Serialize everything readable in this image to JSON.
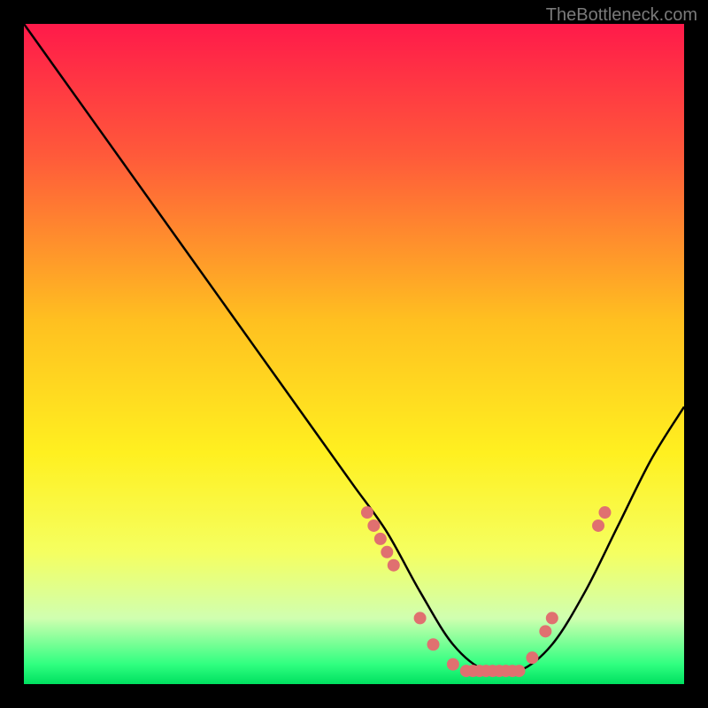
{
  "watermark": "TheBottleneck.com",
  "chart_data": {
    "type": "line",
    "title": "",
    "xlabel": "",
    "ylabel": "",
    "xlim": [
      0,
      100
    ],
    "ylim": [
      0,
      100
    ],
    "curve": {
      "name": "bottleneck-curve",
      "x": [
        0,
        5,
        10,
        15,
        20,
        25,
        30,
        35,
        40,
        45,
        50,
        55,
        60,
        65,
        70,
        75,
        80,
        85,
        90,
        95,
        100
      ],
      "y": [
        100,
        93,
        86,
        79,
        72,
        65,
        58,
        51,
        44,
        37,
        30,
        23,
        14,
        6,
        2,
        2,
        6,
        14,
        24,
        34,
        42
      ]
    },
    "markers": [
      {
        "x": 52,
        "y": 26
      },
      {
        "x": 53,
        "y": 24
      },
      {
        "x": 54,
        "y": 22
      },
      {
        "x": 55,
        "y": 20
      },
      {
        "x": 56,
        "y": 18
      },
      {
        "x": 60,
        "y": 10
      },
      {
        "x": 62,
        "y": 6
      },
      {
        "x": 65,
        "y": 3
      },
      {
        "x": 67,
        "y": 2
      },
      {
        "x": 68,
        "y": 2
      },
      {
        "x": 69,
        "y": 2
      },
      {
        "x": 70,
        "y": 2
      },
      {
        "x": 71,
        "y": 2
      },
      {
        "x": 72,
        "y": 2
      },
      {
        "x": 73,
        "y": 2
      },
      {
        "x": 74,
        "y": 2
      },
      {
        "x": 75,
        "y": 2
      },
      {
        "x": 77,
        "y": 4
      },
      {
        "x": 79,
        "y": 8
      },
      {
        "x": 80,
        "y": 10
      },
      {
        "x": 87,
        "y": 24
      },
      {
        "x": 88,
        "y": 26
      }
    ],
    "gradient_stops": [
      {
        "pos": 0,
        "color": "#ff1a4a"
      },
      {
        "pos": 20,
        "color": "#ff5a3a"
      },
      {
        "pos": 45,
        "color": "#ffc020"
      },
      {
        "pos": 65,
        "color": "#fff020"
      },
      {
        "pos": 80,
        "color": "#f5ff60"
      },
      {
        "pos": 90,
        "color": "#d0ffb0"
      },
      {
        "pos": 97,
        "color": "#30ff80"
      },
      {
        "pos": 100,
        "color": "#00e060"
      }
    ],
    "marker_color": "#e07070",
    "curve_color": "#000000"
  }
}
